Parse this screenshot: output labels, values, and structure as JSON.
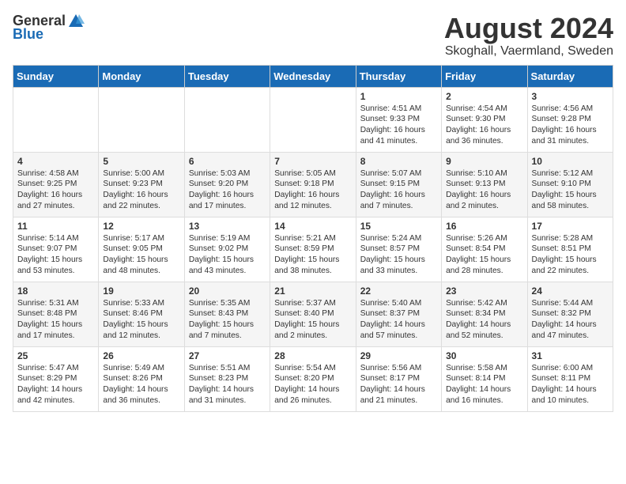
{
  "logo": {
    "general": "General",
    "blue": "Blue"
  },
  "title": "August 2024",
  "location": "Skoghall, Vaermland, Sweden",
  "days_of_week": [
    "Sunday",
    "Monday",
    "Tuesday",
    "Wednesday",
    "Thursday",
    "Friday",
    "Saturday"
  ],
  "weeks": [
    [
      {
        "day": "",
        "content": ""
      },
      {
        "day": "",
        "content": ""
      },
      {
        "day": "",
        "content": ""
      },
      {
        "day": "",
        "content": ""
      },
      {
        "day": "1",
        "content": "Sunrise: 4:51 AM\nSunset: 9:33 PM\nDaylight: 16 hours\nand 41 minutes."
      },
      {
        "day": "2",
        "content": "Sunrise: 4:54 AM\nSunset: 9:30 PM\nDaylight: 16 hours\nand 36 minutes."
      },
      {
        "day": "3",
        "content": "Sunrise: 4:56 AM\nSunset: 9:28 PM\nDaylight: 16 hours\nand 31 minutes."
      }
    ],
    [
      {
        "day": "4",
        "content": "Sunrise: 4:58 AM\nSunset: 9:25 PM\nDaylight: 16 hours\nand 27 minutes."
      },
      {
        "day": "5",
        "content": "Sunrise: 5:00 AM\nSunset: 9:23 PM\nDaylight: 16 hours\nand 22 minutes."
      },
      {
        "day": "6",
        "content": "Sunrise: 5:03 AM\nSunset: 9:20 PM\nDaylight: 16 hours\nand 17 minutes."
      },
      {
        "day": "7",
        "content": "Sunrise: 5:05 AM\nSunset: 9:18 PM\nDaylight: 16 hours\nand 12 minutes."
      },
      {
        "day": "8",
        "content": "Sunrise: 5:07 AM\nSunset: 9:15 PM\nDaylight: 16 hours\nand 7 minutes."
      },
      {
        "day": "9",
        "content": "Sunrise: 5:10 AM\nSunset: 9:13 PM\nDaylight: 16 hours\nand 2 minutes."
      },
      {
        "day": "10",
        "content": "Sunrise: 5:12 AM\nSunset: 9:10 PM\nDaylight: 15 hours\nand 58 minutes."
      }
    ],
    [
      {
        "day": "11",
        "content": "Sunrise: 5:14 AM\nSunset: 9:07 PM\nDaylight: 15 hours\nand 53 minutes."
      },
      {
        "day": "12",
        "content": "Sunrise: 5:17 AM\nSunset: 9:05 PM\nDaylight: 15 hours\nand 48 minutes."
      },
      {
        "day": "13",
        "content": "Sunrise: 5:19 AM\nSunset: 9:02 PM\nDaylight: 15 hours\nand 43 minutes."
      },
      {
        "day": "14",
        "content": "Sunrise: 5:21 AM\nSunset: 8:59 PM\nDaylight: 15 hours\nand 38 minutes."
      },
      {
        "day": "15",
        "content": "Sunrise: 5:24 AM\nSunset: 8:57 PM\nDaylight: 15 hours\nand 33 minutes."
      },
      {
        "day": "16",
        "content": "Sunrise: 5:26 AM\nSunset: 8:54 PM\nDaylight: 15 hours\nand 28 minutes."
      },
      {
        "day": "17",
        "content": "Sunrise: 5:28 AM\nSunset: 8:51 PM\nDaylight: 15 hours\nand 22 minutes."
      }
    ],
    [
      {
        "day": "18",
        "content": "Sunrise: 5:31 AM\nSunset: 8:48 PM\nDaylight: 15 hours\nand 17 minutes."
      },
      {
        "day": "19",
        "content": "Sunrise: 5:33 AM\nSunset: 8:46 PM\nDaylight: 15 hours\nand 12 minutes."
      },
      {
        "day": "20",
        "content": "Sunrise: 5:35 AM\nSunset: 8:43 PM\nDaylight: 15 hours\nand 7 minutes."
      },
      {
        "day": "21",
        "content": "Sunrise: 5:37 AM\nSunset: 8:40 PM\nDaylight: 15 hours\nand 2 minutes."
      },
      {
        "day": "22",
        "content": "Sunrise: 5:40 AM\nSunset: 8:37 PM\nDaylight: 14 hours\nand 57 minutes."
      },
      {
        "day": "23",
        "content": "Sunrise: 5:42 AM\nSunset: 8:34 PM\nDaylight: 14 hours\nand 52 minutes."
      },
      {
        "day": "24",
        "content": "Sunrise: 5:44 AM\nSunset: 8:32 PM\nDaylight: 14 hours\nand 47 minutes."
      }
    ],
    [
      {
        "day": "25",
        "content": "Sunrise: 5:47 AM\nSunset: 8:29 PM\nDaylight: 14 hours\nand 42 minutes."
      },
      {
        "day": "26",
        "content": "Sunrise: 5:49 AM\nSunset: 8:26 PM\nDaylight: 14 hours\nand 36 minutes."
      },
      {
        "day": "27",
        "content": "Sunrise: 5:51 AM\nSunset: 8:23 PM\nDaylight: 14 hours\nand 31 minutes."
      },
      {
        "day": "28",
        "content": "Sunrise: 5:54 AM\nSunset: 8:20 PM\nDaylight: 14 hours\nand 26 minutes."
      },
      {
        "day": "29",
        "content": "Sunrise: 5:56 AM\nSunset: 8:17 PM\nDaylight: 14 hours\nand 21 minutes."
      },
      {
        "day": "30",
        "content": "Sunrise: 5:58 AM\nSunset: 8:14 PM\nDaylight: 14 hours\nand 16 minutes."
      },
      {
        "day": "31",
        "content": "Sunrise: 6:00 AM\nSunset: 8:11 PM\nDaylight: 14 hours\nand 10 minutes."
      }
    ]
  ]
}
